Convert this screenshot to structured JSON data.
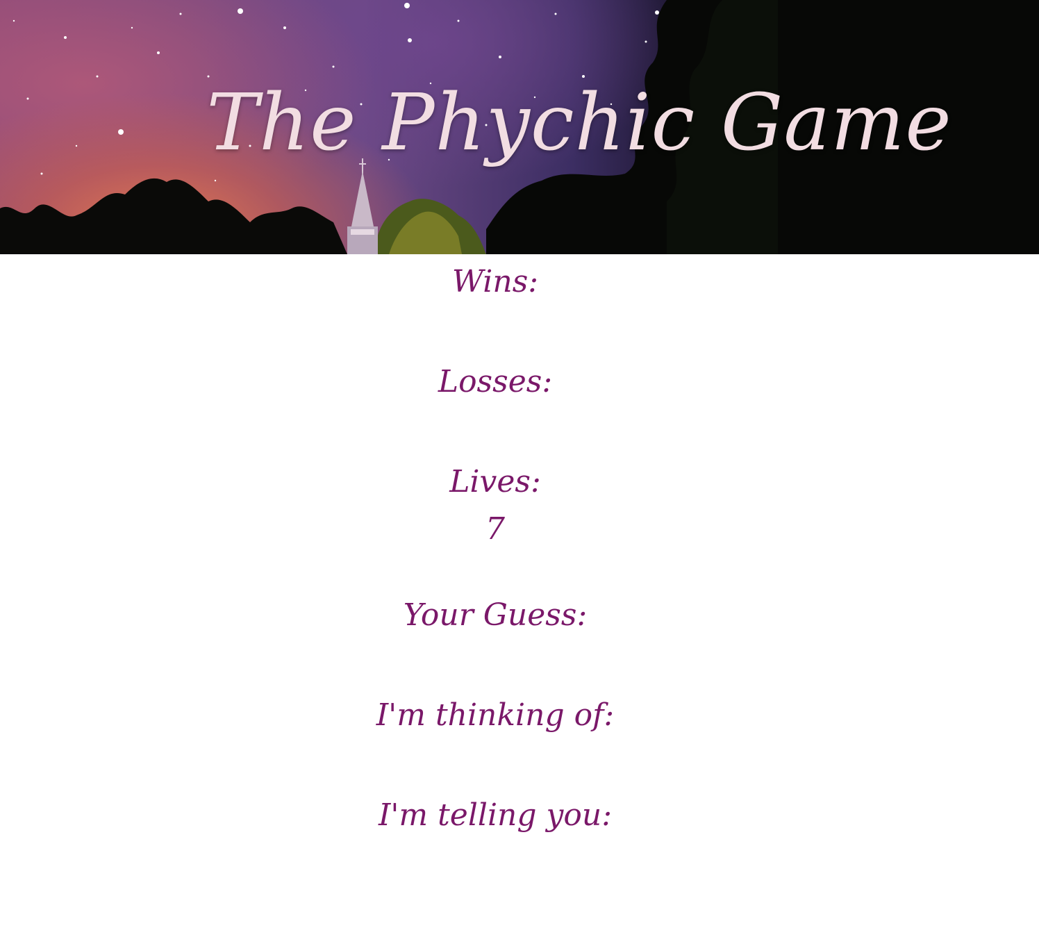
{
  "page": {
    "title": "The Phychic Game"
  },
  "hero": {
    "background": "starry night sky over church steeple and trees",
    "title_color": "#f2dde2"
  },
  "stats": {
    "wins": {
      "label": "Wins:",
      "value": ""
    },
    "losses": {
      "label": "Losses:",
      "value": ""
    },
    "lives": {
      "label": "Lives:",
      "value": "7"
    },
    "guess": {
      "label": "Your Guess:",
      "value": ""
    },
    "thinking": {
      "label": "I'm thinking of:",
      "value": ""
    },
    "telling": {
      "label": "I'm telling you:",
      "value": ""
    }
  },
  "colors": {
    "text_accent": "#7a1869",
    "background": "#ffffff"
  }
}
